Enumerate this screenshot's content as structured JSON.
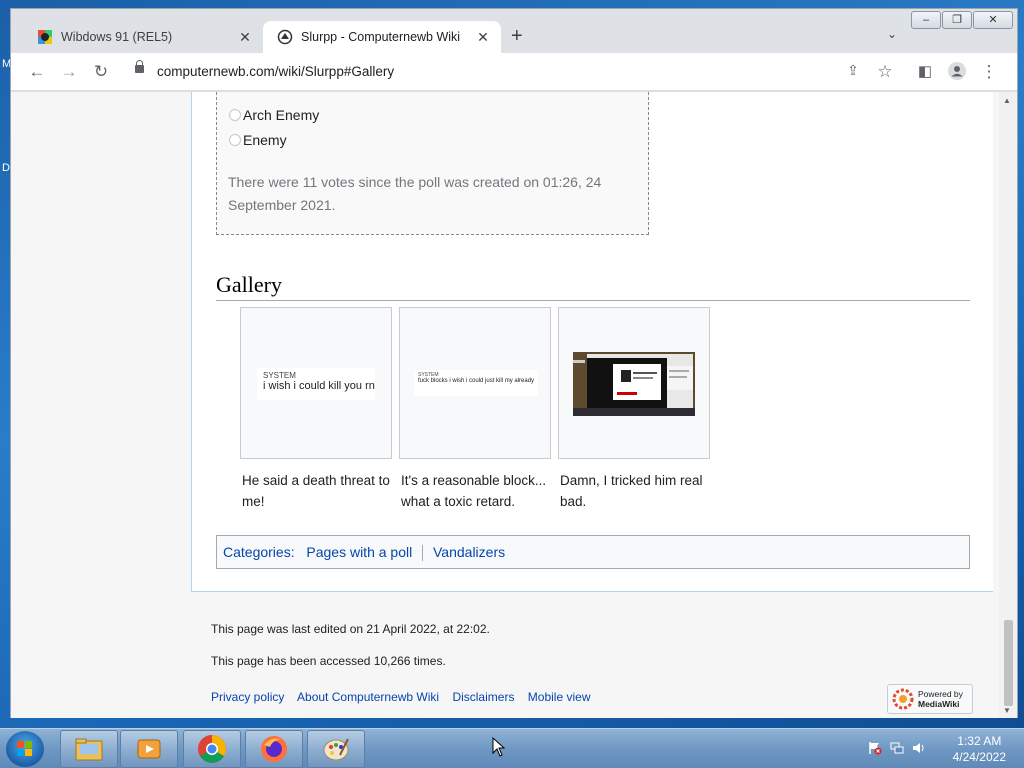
{
  "browser": {
    "tabs": [
      {
        "title": "Wibdows 91 (REL5)",
        "active": false
      },
      {
        "title": "Slurpp - Computernewb Wiki",
        "active": true
      }
    ],
    "url": "computernewb.com/wiki/Slurpp#Gallery"
  },
  "poll": {
    "options": [
      "Arch Enemy",
      "Enemy"
    ],
    "note": "There were 11 votes since the poll was created on 01:26, 24 September 2021."
  },
  "gallery": {
    "heading": "Gallery",
    "items": [
      {
        "caption": "He said a death threat to me!",
        "thumb_label": "SYSTEM",
        "thumb_text": "i wish i could kill you rn"
      },
      {
        "caption": "It's a reasonable block... what a toxic retard.",
        "thumb_label": "SYSTEM",
        "thumb_text": "fuck blocks i wish i could just kill my already"
      },
      {
        "caption": "Damn, I tricked him real bad."
      }
    ]
  },
  "categories": {
    "label": "Categories:",
    "items": [
      "Pages with a poll",
      "Vandalizers"
    ]
  },
  "footer": {
    "last_edited": "This page was last edited on 21 April 2022, at 22:02.",
    "accessed": "This page has been accessed 10,266 times.",
    "links": [
      "Privacy policy",
      "About Computernewb Wiki",
      "Disclaimers",
      "Mobile view"
    ],
    "powered_by": "Powered by",
    "powered_name": "MediaWiki"
  },
  "taskbar": {
    "time": "1:32 AM",
    "date": "4/24/2022"
  },
  "desktop": {
    "letters": [
      "M",
      "D"
    ]
  }
}
